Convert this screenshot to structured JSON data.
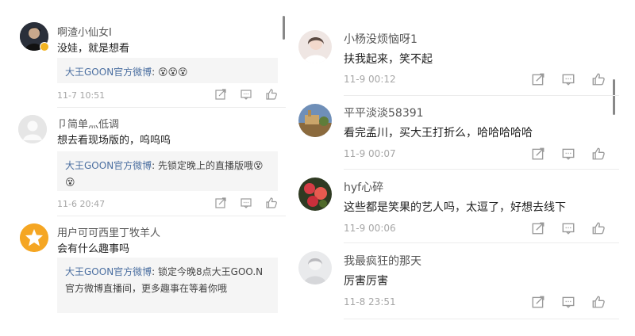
{
  "left_comments": [
    {
      "username": "啊渣小仙女I",
      "text": "没娃，就是想看",
      "reply_author": "大王GOON官方微博",
      "reply_text": "",
      "reply_emoji": "😵😵😵",
      "timestamp": "11-7 10:51",
      "avatar": "photo-avatar",
      "verified": true
    },
    {
      "username": "卩简单灬低调",
      "text": "想去看现场版的，呜呜呜",
      "reply_author": "大王GOON官方微博",
      "reply_text": "先锁定晚上的直播版哦",
      "reply_emoji": "😵😵",
      "timestamp": "11-6 20:47",
      "avatar": "default-avatar"
    },
    {
      "username": "用户可可西里丁牧羊人",
      "text": "会有什么趣事吗",
      "reply_author": "大王GOON官方微博",
      "reply_text": "锁定今晚8点大王GOO.N官方微博直播间，更多趣事在等着你哦",
      "timestamp": "",
      "avatar": "star-avatar"
    }
  ],
  "right_comments": [
    {
      "username": "小杨没烦恼呀1",
      "text": "扶我起来，笑不起",
      "timestamp": "11-9 00:12",
      "avatar": "girl-avatar"
    },
    {
      "username": "平平淡淡58391",
      "text": "看完孟川，买大王打折么，哈哈哈哈哈",
      "timestamp": "11-9 00:07",
      "avatar": "landscape-avatar"
    },
    {
      "username": "hyf心碎",
      "text": "这些都是笑果的艺人吗，太逗了，好想去线下",
      "timestamp": "11-9 00:06",
      "avatar": "flower-avatar"
    },
    {
      "username": "我最疯狂的那天",
      "text": "厉害厉害",
      "timestamp": "11-8 23:51",
      "avatar": "portrait-avatar"
    }
  ],
  "actions": [
    "share-icon",
    "comment-icon",
    "like-icon"
  ],
  "colors": {
    "reply_author": "#4a6ea0",
    "reply_bg": "#f5f5f5",
    "timestamp": "#a6a6a6"
  }
}
